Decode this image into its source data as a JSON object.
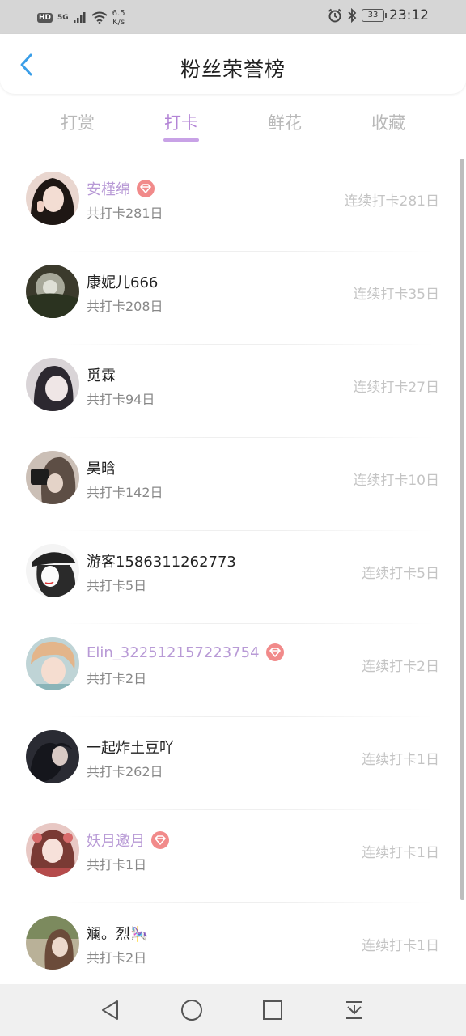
{
  "status_bar": {
    "hd": "HD",
    "network": "5G",
    "speed_value": "6.5",
    "speed_unit": "K/s",
    "battery": "33",
    "time": "23:12"
  },
  "header": {
    "title": "粉丝荣誉榜",
    "back_icon": "chevron-left-icon",
    "accent_color": "#3a9ee8"
  },
  "tabs": [
    {
      "label": "打赏",
      "active": false
    },
    {
      "label": "打卡",
      "active": true
    },
    {
      "label": "鲜花",
      "active": false
    },
    {
      "label": "收藏",
      "active": false
    }
  ],
  "colors": {
    "active_tab": "#b384d6",
    "vip_name": "#b89ad6",
    "badge": "#f18a8a",
    "muted": "#c4c4c4"
  },
  "fans": [
    {
      "name": "安槿绵",
      "vip": true,
      "total": "共打卡281日",
      "streak": "连续打卡281日"
    },
    {
      "name": "康妮儿666",
      "vip": false,
      "total": "共打卡208日",
      "streak": "连续打卡35日"
    },
    {
      "name": "觅霖",
      "vip": false,
      "total": "共打卡94日",
      "streak": "连续打卡27日"
    },
    {
      "name": "昊晗",
      "vip": false,
      "total": "共打卡142日",
      "streak": "连续打卡10日"
    },
    {
      "name": "游客1586311262773",
      "vip": false,
      "total": "共打卡5日",
      "streak": "连续打卡5日"
    },
    {
      "name": "Elin_322512157223754",
      "vip": true,
      "total": "共打卡2日",
      "streak": "连续打卡2日"
    },
    {
      "name": "一起炸土豆吖",
      "vip": false,
      "total": "共打卡262日",
      "streak": "连续打卡1日"
    },
    {
      "name": "妖月邀月",
      "vip": true,
      "total": "共打卡1日",
      "streak": "连续打卡1日"
    },
    {
      "name": "斓。烈🎠",
      "vip": false,
      "total": "共打卡2日",
      "streak": "连续打卡1日"
    }
  ],
  "nav": {
    "back_icon": "triangle-back-icon",
    "home_icon": "circle-home-icon",
    "recents_icon": "square-recents-icon",
    "menu_icon": "pull-down-icon"
  }
}
